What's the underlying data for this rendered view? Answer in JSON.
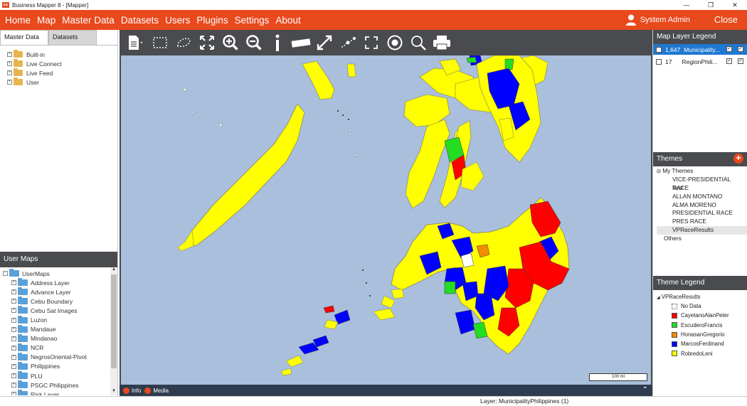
{
  "window": {
    "title": "Business Mapper 8 - [Mapper]",
    "logo_text": "BM"
  },
  "menu": {
    "items": [
      "Home",
      "Map",
      "Master Data",
      "Datasets",
      "Users",
      "Plugins",
      "Settings",
      "About"
    ],
    "user": "System Admin",
    "close": "Close"
  },
  "left": {
    "tabs": [
      "Master Data",
      "Datasets"
    ],
    "tree": [
      "Built-in",
      "Live Connect",
      "Live Feed",
      "User"
    ],
    "user_maps_title": "User Maps",
    "user_maps_root": "UserMaps",
    "user_maps": [
      "Address Layer",
      "Advance Layer",
      "Cebu Boundary",
      "Cebu Sat Images",
      "Luzon",
      "Mandaue",
      "Mindanao",
      "NCR",
      "NegrosOriental-Pivot",
      "Philippines",
      "PLU",
      "PSGC Philippines",
      "Risk Layer"
    ]
  },
  "map": {
    "scale_label": "100 mi",
    "footer": {
      "info": "Info",
      "media": "Media"
    },
    "colors": {
      "sea": "#a9bfdb",
      "yellow": "#ffff00",
      "red": "#ff0000",
      "blue": "#0000ff",
      "green": "#22dd22",
      "orange": "#f28c00"
    }
  },
  "right": {
    "legend_title": "Map Layer Legend",
    "layers": [
      {
        "count": "1,647",
        "name": "Municipality..."
      },
      {
        "count": "17",
        "name": "RegionPhili..."
      }
    ],
    "themes_title": "Themes",
    "themes_root": "My Themes",
    "themes": [
      "VICE-PRESIDENTIAL RACE",
      "Test",
      "ALLAN MONTANO",
      "ALMA MORENO",
      "PRESIDENTIAL RACE",
      "PRES RACE",
      "VPRaceResults"
    ],
    "themes_other": "Others",
    "theme_legend_title": "Theme Legend",
    "theme_legend_root": "VPRaceResults",
    "legend_items": [
      {
        "label": "No Data",
        "color": "#ffffff"
      },
      {
        "label": "CayetanoAlanPeter",
        "color": "#ff0000"
      },
      {
        "label": "EscuderoFrancis",
        "color": "#22dd22"
      },
      {
        "label": "HonasanGregorio",
        "color": "#f28c00"
      },
      {
        "label": "MarcosFerdinand",
        "color": "#0000ff"
      },
      {
        "label": "RobredoLeni",
        "color": "#ffff00"
      }
    ]
  },
  "status": {
    "layer": "Layer: MunicipalityPhilippines (1)"
  }
}
